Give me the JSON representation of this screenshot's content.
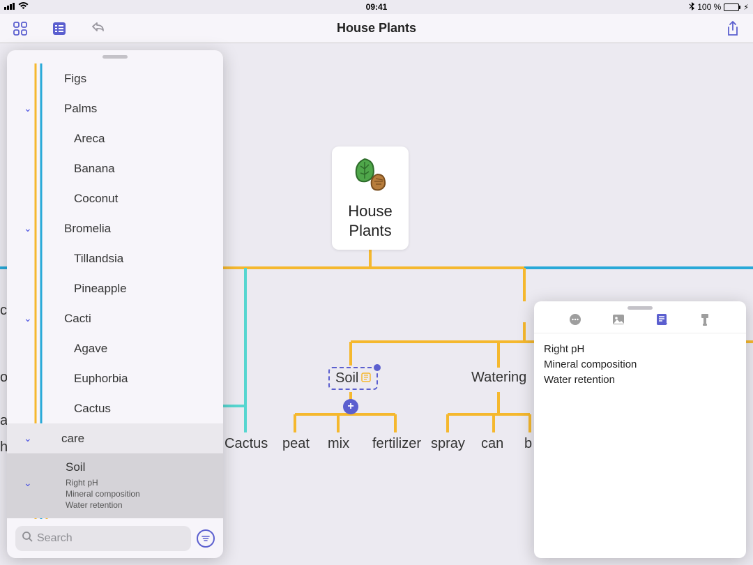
{
  "status": {
    "time": "09:41",
    "battery_text": "100 %"
  },
  "toolbar": {
    "title": "House Plants"
  },
  "root": {
    "title": "House\nPlants"
  },
  "map_nodes": {
    "cut_left": "o",
    "cut_left2": "a",
    "cut_right": "ht",
    "care": "care",
    "soil": "Soil",
    "watering": "Watering",
    "cactus": "Cactus",
    "peat": "peat",
    "mix": "mix",
    "fertilizer": "fertilizer",
    "spray": "spray",
    "can": "can",
    "b_cut": "b"
  },
  "sidebar": {
    "items": [
      {
        "label": "Figs",
        "indent": 1,
        "chevron": false
      },
      {
        "label": "Palms",
        "indent": 1,
        "chevron": true
      },
      {
        "label": "Areca",
        "indent": 2,
        "chevron": false
      },
      {
        "label": "Banana",
        "indent": 2,
        "chevron": false
      },
      {
        "label": "Coconut",
        "indent": 2,
        "chevron": false
      },
      {
        "label": "Bromelia",
        "indent": 1,
        "chevron": true
      },
      {
        "label": "Tillandsia",
        "indent": 2,
        "chevron": false
      },
      {
        "label": "Pineapple",
        "indent": 2,
        "chevron": false
      },
      {
        "label": "Cacti",
        "indent": 1,
        "chevron": true
      },
      {
        "label": "Agave",
        "indent": 2,
        "chevron": false
      },
      {
        "label": "Euphorbia",
        "indent": 2,
        "chevron": false
      },
      {
        "label": "Cactus",
        "indent": 2,
        "chevron": false
      }
    ],
    "care": "care",
    "soil_title": "Soil",
    "soil_notes": "Right pH\nMineral composition\nWater retention",
    "search_placeholder": "Search"
  },
  "notes": {
    "body": "Right pH\nMineral composition\nWater retention"
  }
}
